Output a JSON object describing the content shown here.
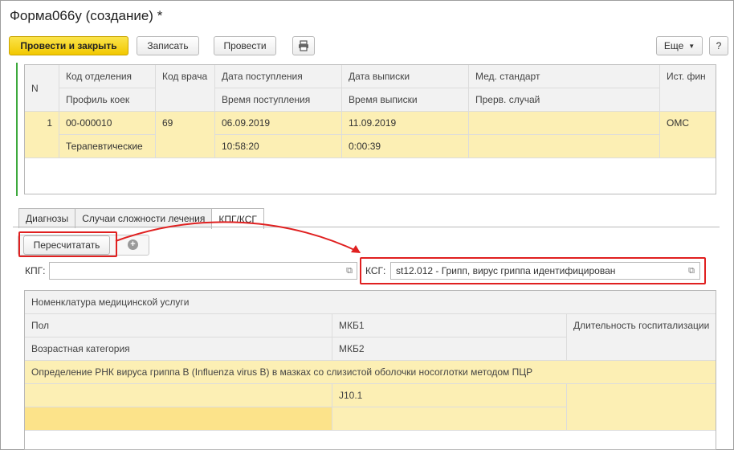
{
  "window": {
    "title": "Форма066у (создание) *"
  },
  "toolbar": {
    "post_close": "Провести и закрыть",
    "save": "Записать",
    "post": "Провести",
    "more": "Еще",
    "help": "?"
  },
  "main_table": {
    "header_row1": [
      "N",
      "Код отделения",
      "Код врача",
      "Дата поступления",
      "Дата выписки",
      "Мед. стандарт",
      "Ист. фин"
    ],
    "header_row2": [
      "Профиль коек",
      "Время поступления",
      "Время выписки",
      "Прерв. случай"
    ],
    "row": {
      "n": "1",
      "dept_code": "00-000010",
      "doctor_code": "69",
      "admission_date": "06.09.2019",
      "discharge_date": "11.09.2019",
      "fin_source": "ОМС",
      "bed_profile": "Терапевтические",
      "admission_time": "10:58:20",
      "discharge_time": "0:00:39"
    }
  },
  "tabs": [
    "Диагнозы",
    "Случаи сложности лечения",
    "КПГ/КСГ"
  ],
  "recalc_button": "Пересчитатать",
  "kpg": {
    "label": "КПГ:",
    "value": ""
  },
  "ksg": {
    "label": "КСГ:",
    "value": "st12.012 - Грипп, вирус гриппа идентифицирован"
  },
  "services_table": {
    "header1": "Номенклатура медицинской услуги",
    "header2": [
      "Пол",
      "МКБ1",
      "Длительность госпитализации"
    ],
    "header3": [
      "Возрастная категория",
      "МКБ2"
    ],
    "row_name": "Определение РНК вируса гриппа B (Influenza virus B) в мазках со слизистой оболочки носоглотки методом ПЦР",
    "row_mkb1": "J10.1"
  },
  "colors": {
    "accent_yellow": "#f5cf00",
    "selection": "#fcefb4",
    "highlight_red": "#e02020",
    "green_marker": "#3da93d"
  }
}
